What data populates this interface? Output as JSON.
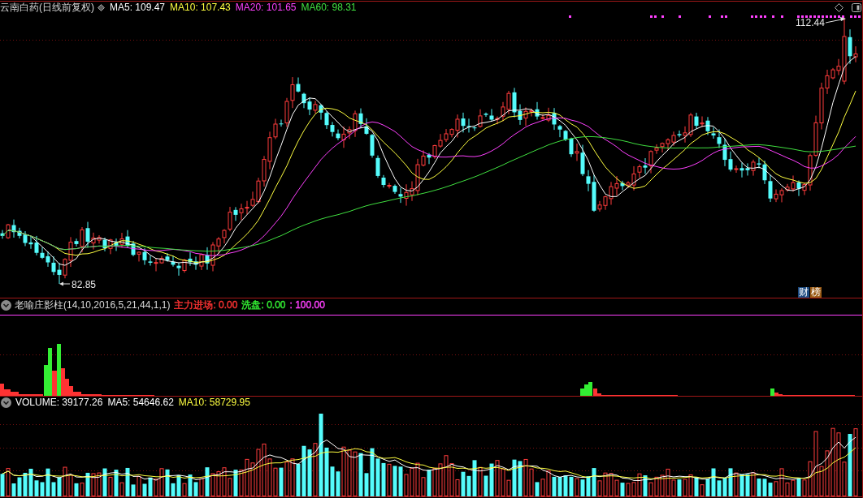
{
  "main_panel": {
    "title": "云南白药(日线前复权)",
    "indicators": [
      {
        "text": "MA5: 109.47",
        "color": "#ffffff"
      },
      {
        "text": "MA10: 107.43",
        "color": "#ffff40"
      },
      {
        "text": "MA20: 101.65",
        "color": "#ff40ff"
      },
      {
        "text": "MA60: 98.31",
        "color": "#40e040"
      }
    ],
    "high_label": "112.44",
    "low_label": "82.85",
    "tags": [
      {
        "text": "财",
        "color": "#1c4a80"
      },
      {
        "text": "榜",
        "color": "#9a5a14"
      }
    ]
  },
  "indicator_panel": {
    "formula": "老喻庄影柱(14,10,2016,5,21,44,1,1)",
    "outputs": [
      {
        "text": "主力进场: 0.00",
        "color": "#ff3333"
      },
      {
        "text": "洗盘: 0.00",
        "color": "#33ee33"
      },
      {
        "text": ": 100.00",
        "color": "#ff40ff"
      }
    ]
  },
  "volume_panel": {
    "indicators": [
      {
        "text": "VOLUME: 39177.26",
        "color": "#ffffff"
      },
      {
        "text": "MA5: 54646.62",
        "color": "#ffffff"
      },
      {
        "text": "MA10: 58729.95",
        "color": "#ffff40"
      }
    ]
  }
}
